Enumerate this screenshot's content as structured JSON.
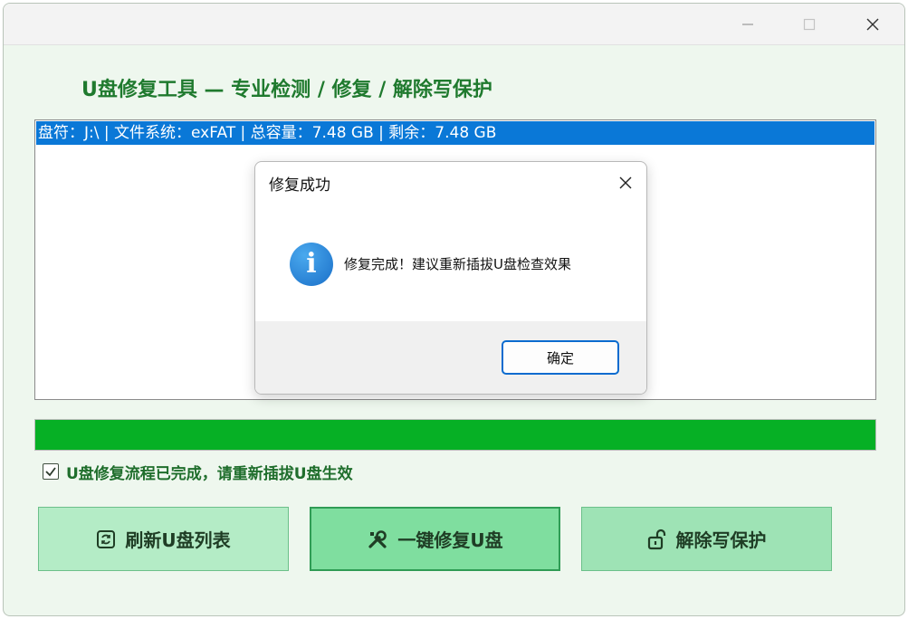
{
  "window": {
    "title": "U盘修复工具 — 专业检测 / 修复 / 解除写保护",
    "controls": [
      "minimize-icon",
      "maximize-icon",
      "close-icon"
    ]
  },
  "drive_list": {
    "items": [
      {
        "label": "盘符：J:\\ | 文件系统：exFAT | 总容量：7.48 GB | 剩余：7.48 GB",
        "selected": true
      }
    ]
  },
  "progress": {
    "percent": 100,
    "color": "#06b025"
  },
  "status": {
    "checked": true,
    "text": "U盘修复流程已完成，请重新插拔U盘生效"
  },
  "buttons": {
    "refresh": {
      "label": "刷新U盘列表",
      "icon": "refresh-icon"
    },
    "repair": {
      "label": "一键修复U盘",
      "icon": "tools-icon"
    },
    "unlock": {
      "label": "解除写保护",
      "icon": "unlock-icon"
    }
  },
  "dialog": {
    "title": "修复成功",
    "icon": "info-icon",
    "message": "修复完成！建议重新插拔U盘检查效果",
    "ok_label": "确定"
  },
  "colors": {
    "accent": "#1f7a2e",
    "selection": "#0a78d7",
    "progress": "#06b025"
  }
}
